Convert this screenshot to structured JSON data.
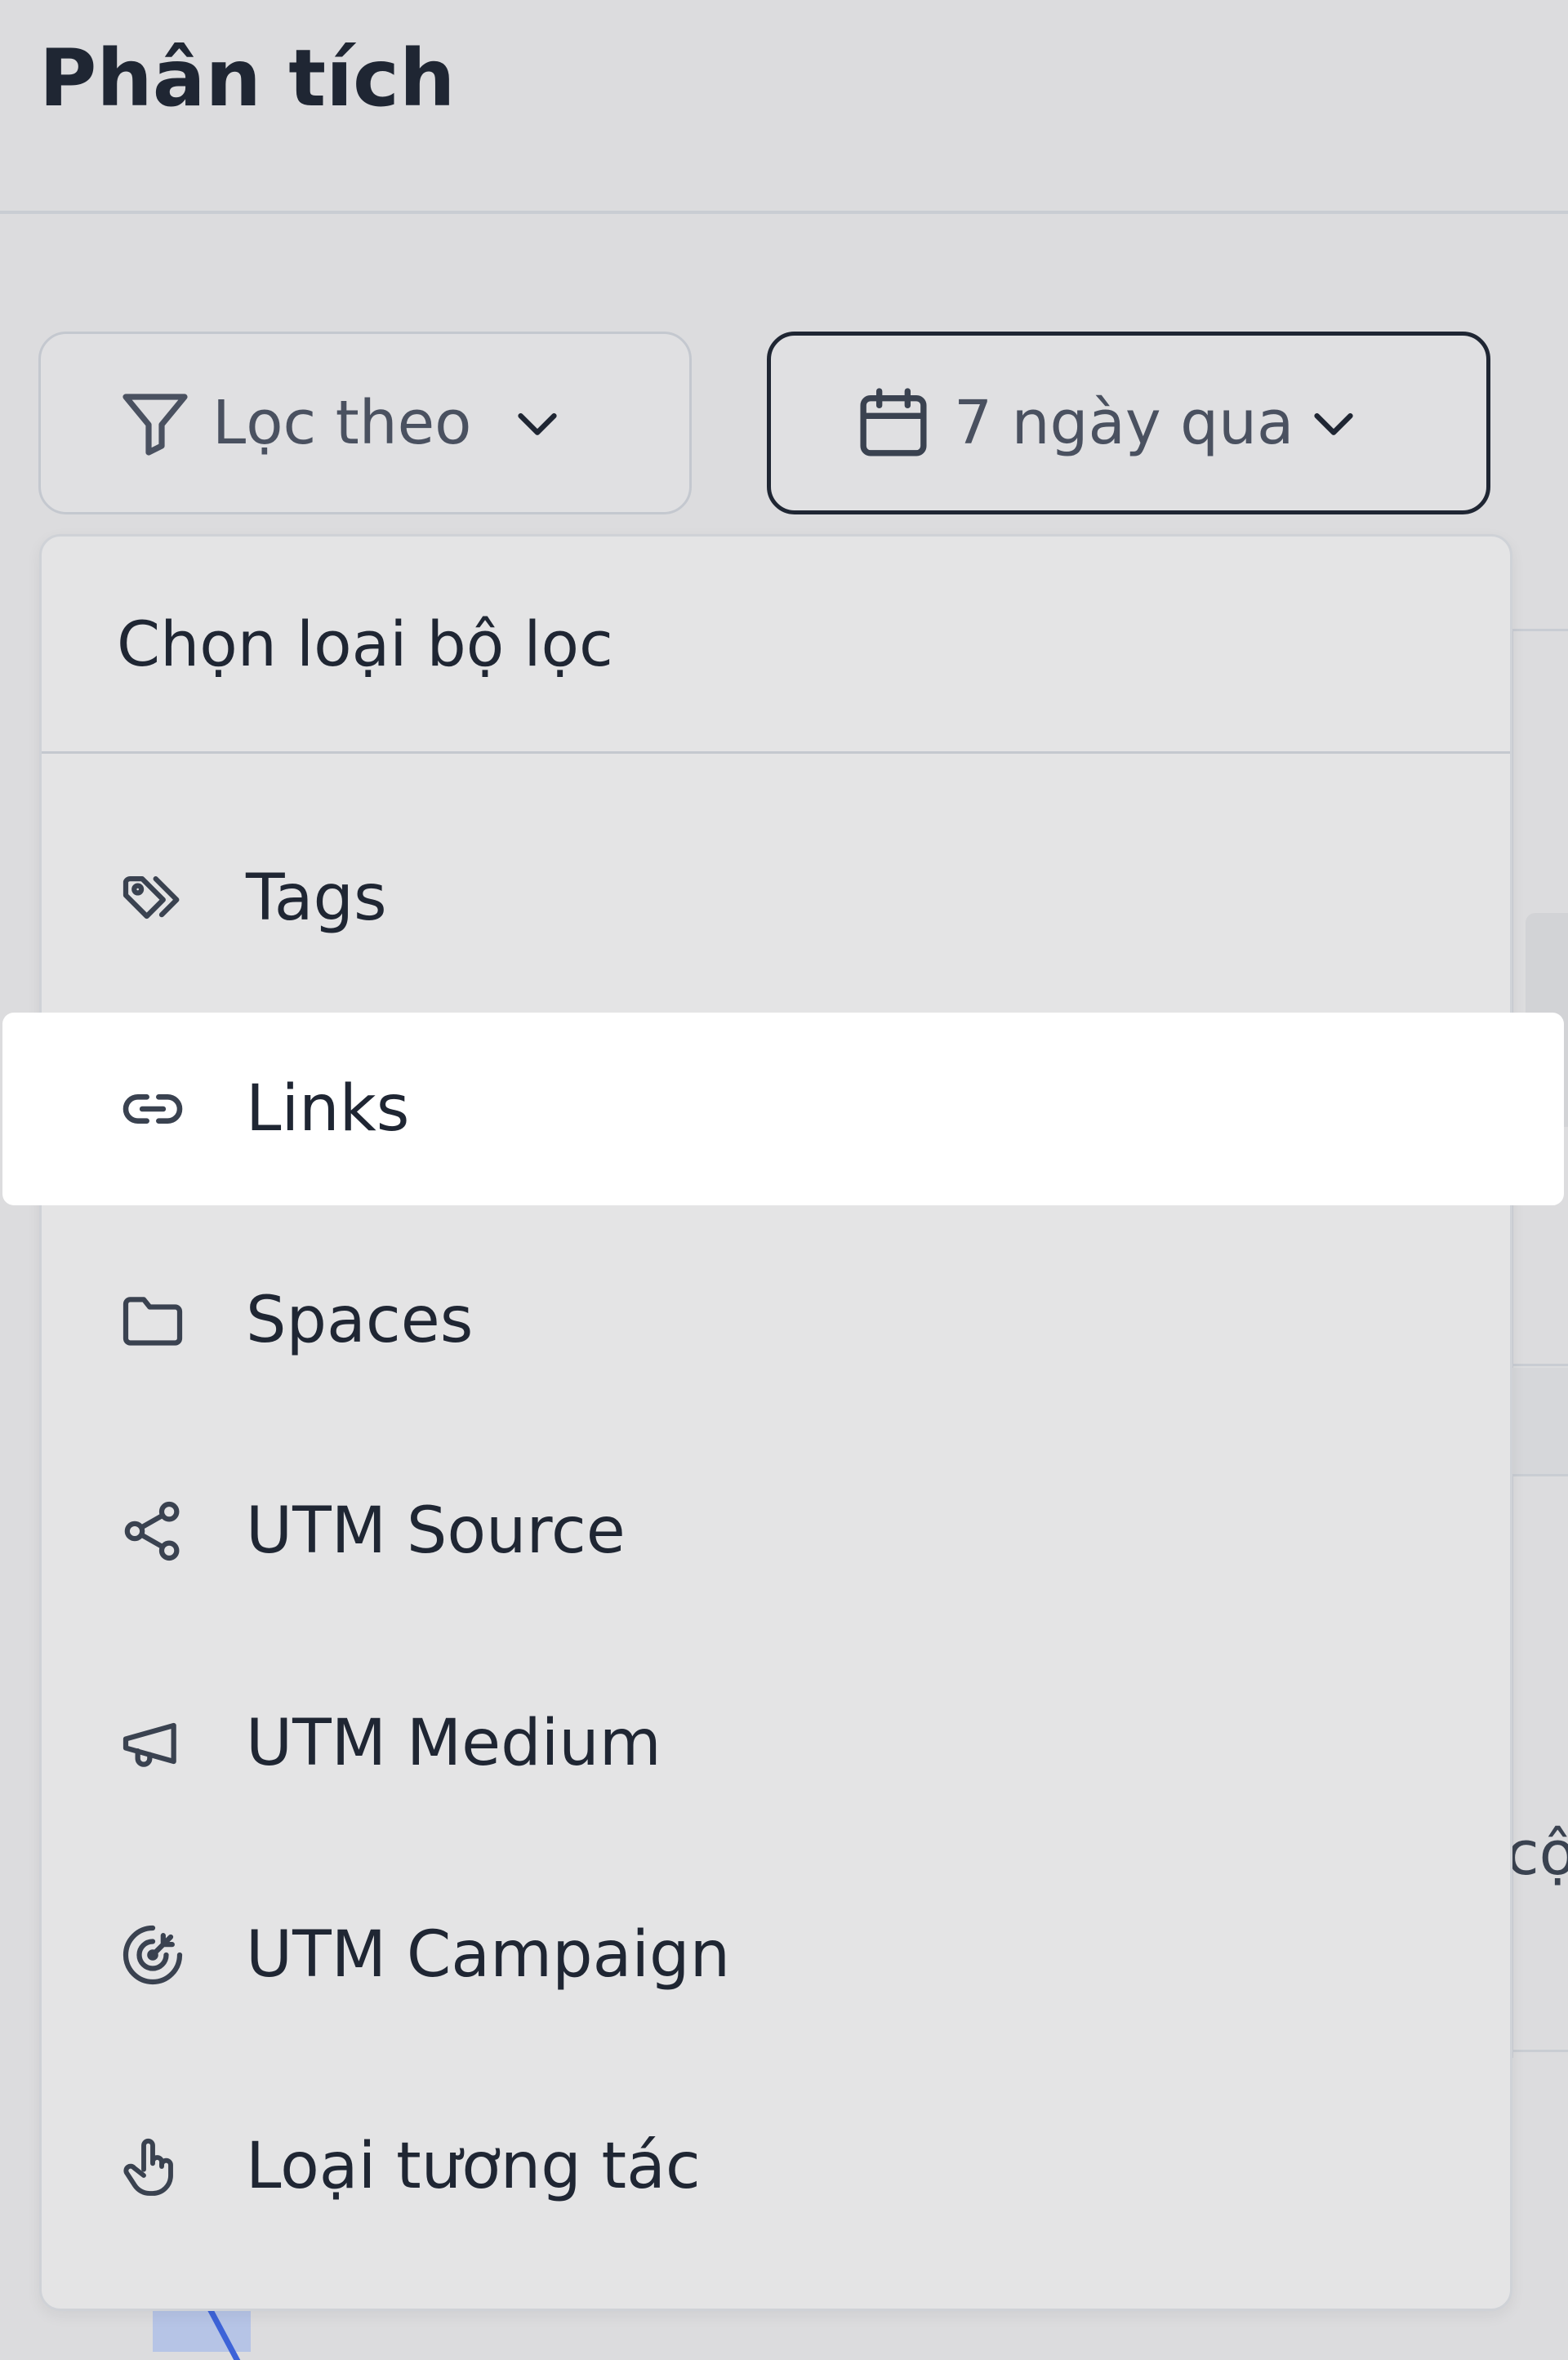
{
  "page": {
    "title": "Phân tích"
  },
  "toolbar": {
    "filter_button": {
      "label": "Lọc theo",
      "icon": "filter-icon"
    },
    "date_button": {
      "label": "7 ngày qua",
      "icon": "calendar-icon"
    }
  },
  "dropdown": {
    "header": "Chọn loại bộ lọc",
    "options": [
      {
        "label": "Tags",
        "icon": "tags-icon"
      },
      {
        "label": "Links",
        "icon": "link-icon",
        "highlighted": true
      },
      {
        "label": "Spaces",
        "icon": "folder-icon"
      },
      {
        "label": "UTM Source",
        "icon": "share-icon"
      },
      {
        "label": "UTM Medium",
        "icon": "megaphone-icon"
      },
      {
        "label": "UTM Campaign",
        "icon": "target-icon"
      },
      {
        "label": "Loại tương tác",
        "icon": "hand-pointer-icon"
      }
    ]
  },
  "background": {
    "partial_text": "cộ"
  },
  "colors": {
    "page_bg": "#dcdcde",
    "text": "#1f2633",
    "muted_text": "#4a5160",
    "highlight": "#ffffff",
    "chart_blue": "#3d63d8"
  }
}
